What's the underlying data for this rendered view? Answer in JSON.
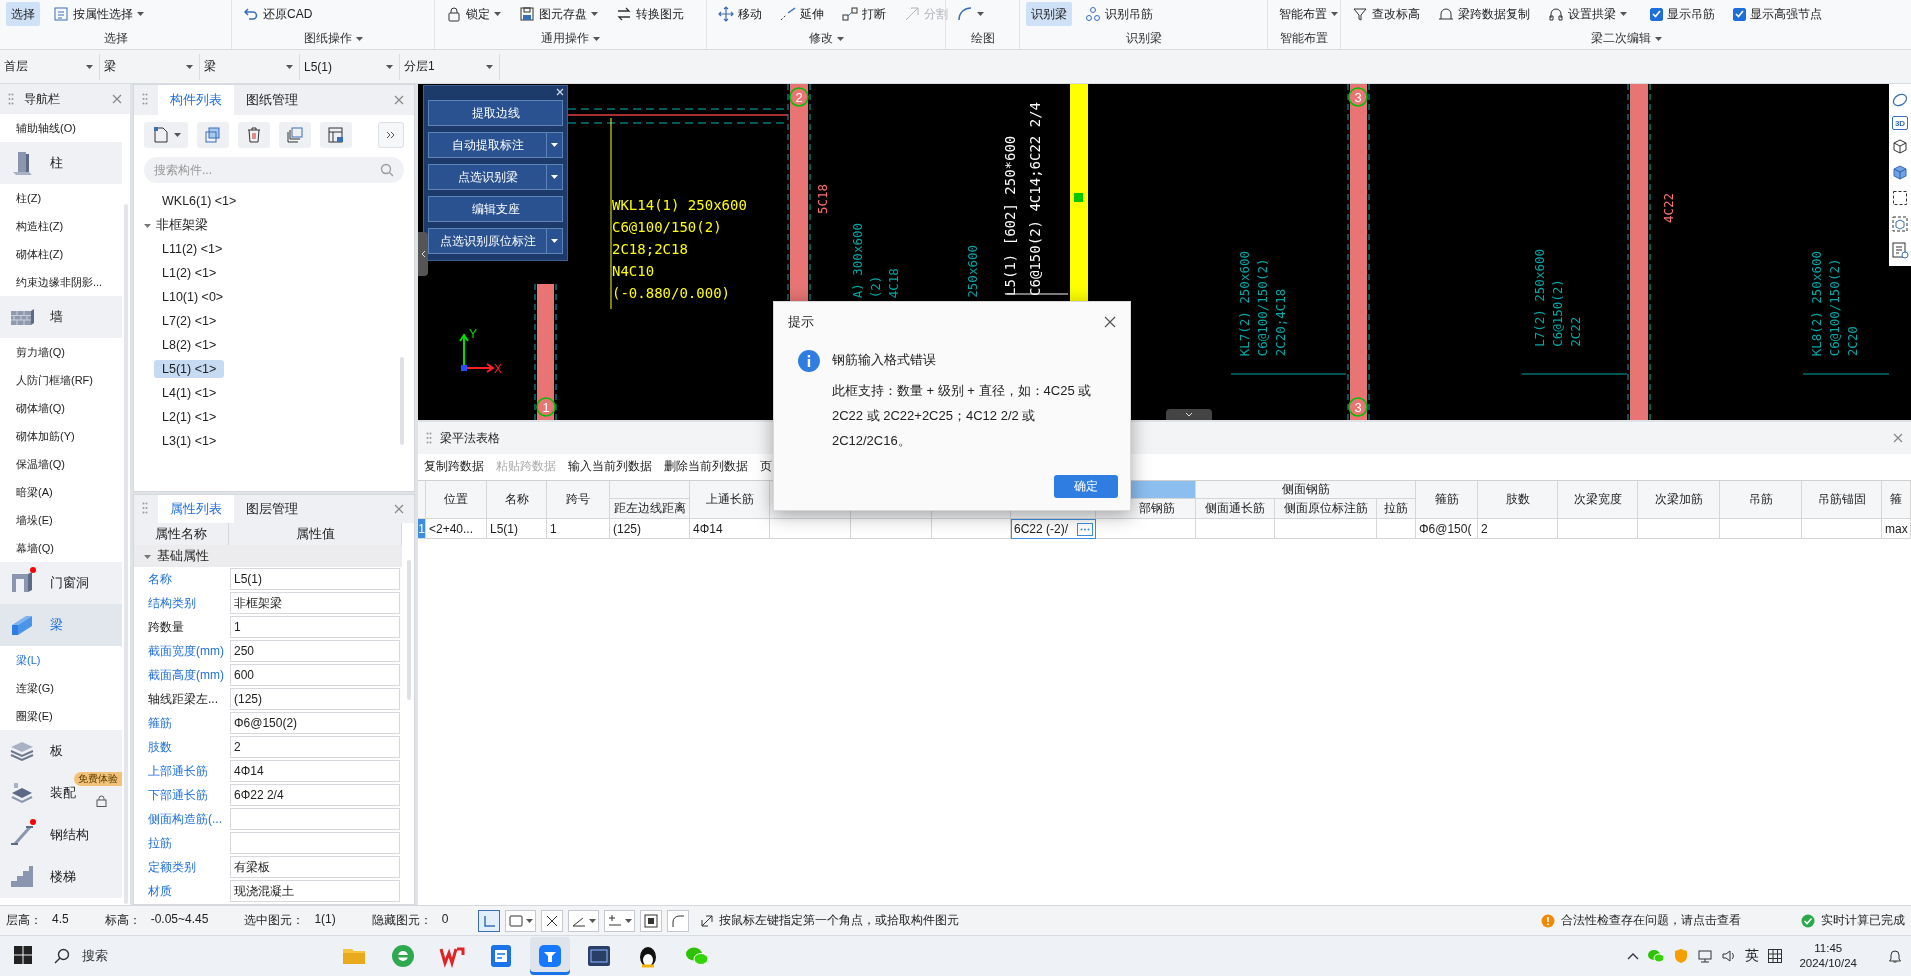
{
  "ribbon": {
    "groups": [
      {
        "label": "选择",
        "caret": false,
        "tools": [
          {
            "kind": "button",
            "label": "选择",
            "selected": true,
            "disabled": false,
            "caret": false
          },
          {
            "kind": "button",
            "label": "按属性选择",
            "selected": false,
            "disabled": false,
            "caret": true
          }
        ]
      },
      {
        "label": "图纸操作",
        "caret": true,
        "tools": [
          {
            "kind": "button",
            "label": "还原CAD",
            "selected": false,
            "disabled": false,
            "caret": false
          }
        ]
      },
      {
        "label": "通用操作",
        "caret": true,
        "tools": [
          {
            "kind": "button",
            "label": "锁定",
            "selected": false,
            "disabled": false,
            "caret": true
          },
          {
            "kind": "button",
            "label": "图元存盘",
            "selected": false,
            "disabled": false,
            "caret": true
          },
          {
            "kind": "button",
            "label": "转换图元",
            "selected": false,
            "disabled": false,
            "caret": false
          }
        ]
      },
      {
        "label": "修改",
        "caret": true,
        "tools": [
          {
            "kind": "button",
            "label": "移动",
            "selected": false,
            "disabled": false,
            "caret": false
          },
          {
            "kind": "button",
            "label": "延伸",
            "selected": false,
            "disabled": false,
            "caret": false
          },
          {
            "kind": "button",
            "label": "打断",
            "selected": false,
            "disabled": false,
            "caret": false
          },
          {
            "kind": "button",
            "label": "分割",
            "selected": false,
            "disabled": true,
            "caret": false
          }
        ]
      },
      {
        "label": "绘图",
        "caret": false,
        "tools": [
          {
            "kind": "button",
            "selected": false,
            "disabled": false,
            "caret": true
          }
        ]
      },
      {
        "label": "识别梁",
        "caret": false,
        "tools": [
          {
            "kind": "button",
            "label": "识别梁",
            "selected": true,
            "disabled": false,
            "caret": false
          },
          {
            "kind": "button",
            "label": "识别吊筋",
            "selected": false,
            "disabled": false,
            "caret": false
          }
        ]
      },
      {
        "label": "智能布置",
        "caret": false,
        "tools": [
          {
            "kind": "button",
            "label": "智能布置",
            "selected": false,
            "disabled": false,
            "caret": true
          }
        ]
      },
      {
        "label": "梁二次编辑",
        "caret": true,
        "tools": [
          {
            "kind": "button",
            "label": "查改标高",
            "selected": false,
            "disabled": false,
            "caret": false
          },
          {
            "kind": "button",
            "label": "梁跨数据复制",
            "selected": false,
            "disabled": false,
            "caret": false
          },
          {
            "kind": "button",
            "label": "设置拱梁",
            "selected": false,
            "disabled": false,
            "caret": true
          },
          {
            "kind": "checkbox",
            "label": "显示吊筋",
            "checked": true
          },
          {
            "kind": "checkbox",
            "label": "显示高强节点",
            "checked": true
          }
        ]
      }
    ]
  },
  "selectors": [
    {
      "value": "首层"
    },
    {
      "value": "梁"
    },
    {
      "value": "梁"
    },
    {
      "value": "L5(1)"
    },
    {
      "value": "分层1"
    }
  ],
  "navigator": {
    "title": "导航栏",
    "entries": [
      {
        "kind": "item",
        "label": "辅助轴线(O)",
        "selected": false
      },
      {
        "kind": "category",
        "label": "柱",
        "selected": false,
        "notified": false
      },
      {
        "kind": "item",
        "label": "柱(Z)",
        "selected": false
      },
      {
        "kind": "item",
        "label": "构造柱(Z)",
        "selected": false
      },
      {
        "kind": "item",
        "label": "砌体柱(Z)",
        "selected": false
      },
      {
        "kind": "item",
        "label": "约束边缘非阴影...",
        "selected": false
      },
      {
        "kind": "category",
        "label": "墙",
        "selected": false,
        "notified": false
      },
      {
        "kind": "item",
        "label": "剪力墙(Q)",
        "selected": false
      },
      {
        "kind": "item",
        "label": "人防门框墙(RF)",
        "selected": false
      },
      {
        "kind": "item",
        "label": "砌体墙(Q)",
        "selected": false
      },
      {
        "kind": "item",
        "label": "砌体加筋(Y)",
        "selected": false
      },
      {
        "kind": "item",
        "label": "保温墙(Q)",
        "selected": false
      },
      {
        "kind": "item",
        "label": "暗梁(A)",
        "selected": false
      },
      {
        "kind": "item",
        "label": "墙垛(E)",
        "selected": false
      },
      {
        "kind": "item",
        "label": "幕墙(Q)",
        "selected": false
      },
      {
        "kind": "category",
        "label": "门窗洞",
        "selected": false,
        "notified": true
      },
      {
        "kind": "category",
        "label": "梁",
        "selected": true,
        "notified": false
      },
      {
        "kind": "item",
        "label": "梁(L)",
        "selected": true
      },
      {
        "kind": "item",
        "label": "连梁(G)",
        "selected": false
      },
      {
        "kind": "item",
        "label": "圈梁(E)",
        "selected": false
      },
      {
        "kind": "category",
        "label": "板",
        "selected": false,
        "notified": false
      },
      {
        "kind": "category",
        "label": "装配",
        "selected": false,
        "notified": false,
        "badge": "免费体验"
      },
      {
        "kind": "category",
        "label": "钢结构",
        "selected": false,
        "notified": true
      },
      {
        "kind": "category",
        "label": "楼梯",
        "selected": false,
        "notified": false
      }
    ]
  },
  "parts_panel": {
    "tabs": [
      {
        "label": "构件列表",
        "selected": true
      },
      {
        "label": "图纸管理",
        "selected": false
      }
    ],
    "search": {
      "placeholder": "搜索构件..."
    },
    "tree": [
      {
        "label": "WKL6(1) <1>",
        "selected": false
      },
      {
        "label": "非框架梁",
        "selected": false,
        "expanded": true,
        "children": [
          {
            "label": "L11(2) <1>",
            "selected": false
          },
          {
            "label": "L1(2) <1>",
            "selected": false
          },
          {
            "label": "L10(1) <0>",
            "selected": false
          },
          {
            "label": "L7(2) <1>",
            "selected": false
          },
          {
            "label": "L8(2) <1>",
            "selected": false
          },
          {
            "label": "L5(1) <1>",
            "selected": true
          },
          {
            "label": "L4(1) <1>",
            "selected": false
          },
          {
            "label": "L2(1) <1>",
            "selected": false
          },
          {
            "label": "L3(1) <1>",
            "selected": false
          }
        ]
      }
    ]
  },
  "properties_panel": {
    "tabs": [
      {
        "label": "属性列表",
        "selected": true
      },
      {
        "label": "图层管理",
        "selected": false
      }
    ],
    "columns": [
      "属性名称",
      "属性值"
    ],
    "groups": [
      {
        "label": "基础属性",
        "expanded": true,
        "rows": [
          {
            "name": "名称",
            "value": "L5(1)",
            "public": true
          },
          {
            "name": "结构类别",
            "value": "非框架梁",
            "public": true
          },
          {
            "name": "跨数量",
            "value": "1",
            "public": false
          },
          {
            "name": "截面宽度(mm)",
            "value": "250",
            "public": true
          },
          {
            "name": "截面高度(mm)",
            "value": "600",
            "public": true
          },
          {
            "name": "轴线距梁左...",
            "value": "(125)",
            "public": false
          },
          {
            "name": "箍筋",
            "value": "Φ6@150(2)",
            "public": true
          },
          {
            "name": "肢数",
            "value": "2",
            "public": true
          },
          {
            "name": "上部通长筋",
            "value": "4Φ14",
            "public": true
          },
          {
            "name": "下部通长筋",
            "value": "6Φ22 2/4",
            "public": true
          },
          {
            "name": "侧面构造筋(...",
            "public": true
          },
          {
            "name": "拉筋",
            "public": true
          },
          {
            "name": "定额类别",
            "value": "有梁板",
            "public": true
          },
          {
            "name": "材质",
            "value": "现浇混凝土",
            "public": true
          }
        ]
      }
    ]
  },
  "cad_view": {
    "tool_panel": {
      "buttons": [
        {
          "label": "提取边线",
          "dropdown": false
        },
        {
          "label": "自动提取标注",
          "dropdown": true
        },
        {
          "label": "点选识别梁",
          "dropdown": true
        },
        {
          "label": "编辑支座",
          "dropdown": false
        },
        {
          "label": "点选识别原位标注",
          "dropdown": true
        }
      ]
    },
    "axis_bubbles": [
      {
        "label": "2"
      },
      {
        "label": "3"
      },
      {
        "label": "1"
      },
      {
        "label": "3"
      }
    ],
    "annotations": [
      {
        "kind": "horizontal",
        "color": "#ffff00",
        "lines": [
          "WKL14(1) 250x600",
          "C6@100/150(2)",
          "2C18;2C18",
          "N4C10",
          "(-0.880/0.000)"
        ]
      },
      {
        "kind": "vertical",
        "color": "#ff7070",
        "lines": [
          "5C18"
        ]
      },
      {
        "kind": "vertical",
        "color": "#00a8a8",
        "lines": [
          "A) 300x600",
          "(2)",
          "4C18"
        ]
      },
      {
        "kind": "vertical",
        "color": "#00a8a8",
        "lines": [
          "250x600"
        ]
      },
      {
        "kind": "vertical",
        "color": "#ffffff",
        "lines": [
          "L5(1) [602] 250*600",
          "C6@150(2) 4C14;6C22 2/4"
        ]
      },
      {
        "kind": "vertical",
        "color": "#00a8a8",
        "lines": [
          "KL7(2) 250x600",
          "C6@100/150(2)",
          "2C20;4C18"
        ]
      },
      {
        "kind": "vertical",
        "color": "#00a8a8",
        "lines": [
          "L7(2) 250x600",
          "C6@150(2)",
          "2C22"
        ]
      },
      {
        "kind": "vertical",
        "color": "#00a8a8",
        "lines": [
          "KL8(2) 250x600",
          "C6@100/150(2)",
          "2C20"
        ]
      },
      {
        "kind": "vertical",
        "color": "#ff7070",
        "lines": [
          "4C22"
        ]
      }
    ],
    "axis_gizmo": {
      "x_label": "X",
      "y_label": "Y"
    },
    "view_toolbar": [
      {
        "kind": "orbit"
      },
      {
        "kind": "text",
        "label": "3D"
      },
      {
        "kind": "cube"
      },
      {
        "kind": "solid-cube"
      },
      {
        "kind": "marquee"
      },
      {
        "kind": "box"
      },
      {
        "kind": "list"
      }
    ]
  },
  "table_panel": {
    "title": "梁平法表格",
    "toolbar": [
      {
        "label": "复制跨数据",
        "disabled": false
      },
      {
        "label": "粘贴跨数据",
        "disabled": true
      },
      {
        "label": "输入当前列数据",
        "disabled": false
      },
      {
        "label": "删除当前列数据",
        "disabled": false
      },
      {
        "label": "页",
        "disabled": false
      }
    ],
    "columns": [
      {
        "kind": "header",
        "label": "位置",
        "grouped": false
      },
      {
        "kind": "header",
        "label": "名称",
        "grouped": false
      },
      {
        "kind": "header",
        "label": "跨号",
        "grouped": false
      },
      {
        "kind": "header",
        "label": "距左边线距离",
        "group": {
          "selected": false
        }
      },
      {
        "kind": "header",
        "label": "上通长筋",
        "grouped": false
      },
      {
        "kind": "blank",
        "grouped": false
      },
      {
        "kind": "blank",
        "grouped": false
      },
      {
        "kind": "blank",
        "grouped": false
      },
      {
        "kind": "blank",
        "group": {
          "selected": true
        }
      },
      {
        "kind": "header",
        "label": "部钢筋",
        "grouped": true
      },
      {
        "kind": "header",
        "label": "侧面通长筋",
        "group": {
          "label": "侧面钢筋",
          "selected": false
        }
      },
      {
        "kind": "header",
        "label": "侧面原位标注筋",
        "grouped": true
      },
      {
        "kind": "header",
        "label": "拉筋",
        "grouped": true
      },
      {
        "kind": "header",
        "label": "箍筋",
        "grouped": false
      },
      {
        "kind": "header",
        "label": "肢数",
        "grouped": false
      },
      {
        "kind": "header",
        "label": "次梁宽度",
        "grouped": false
      },
      {
        "kind": "header",
        "label": "次梁加筋",
        "grouped": false
      },
      {
        "kind": "header",
        "label": "吊筋",
        "grouped": false
      },
      {
        "kind": "header",
        "label": "吊筋锚固",
        "grouped": false
      },
      {
        "kind": "header",
        "label": "箍",
        "grouped": false
      }
    ],
    "rows": [
      {
        "number": "1",
        "selected": true,
        "cells": [
          {
            "text": "<2+40...",
            "editing": false
          },
          {
            "text": "L5(1)",
            "editing": false
          },
          {
            "text": "1",
            "editing": false
          },
          {
            "text": "(125)",
            "editing": false
          },
          {
            "text": "4Φ14",
            "editing": false
          },
          {
            "editing": false
          },
          {
            "editing": false
          },
          {
            "editing": false
          },
          {
            "text": "6C22 (-2)/",
            "editing": true
          },
          {
            "editing": false
          },
          {
            "editing": false
          },
          {
            "editing": false
          },
          {
            "editing": false
          },
          {
            "text": "Φ6@150(",
            "editing": false
          },
          {
            "text": "2",
            "editing": false
          },
          {
            "editing": false
          },
          {
            "editing": false
          },
          {
            "editing": false
          },
          {
            "editing": false
          },
          {
            "text": "max",
            "editing": false
          }
        ]
      }
    ]
  },
  "status_bar": {
    "fields": [
      {
        "label": "层高：",
        "value": "4.5"
      },
      {
        "label": "标高：",
        "value": "-0.05~4.45"
      },
      {
        "label": "选中图元：",
        "value": "1(1)"
      },
      {
        "label": "隐藏图元：",
        "value": "0"
      }
    ],
    "tools": [
      {
        "selected": true,
        "caret": false
      },
      {
        "selected": false,
        "caret": true
      },
      {
        "selected": false,
        "caret": false
      },
      {
        "selected": false,
        "caret": true
      },
      {
        "selected": false,
        "caret": true
      },
      {
        "selected": false,
        "caret": false
      },
      {
        "selected": false,
        "caret": false
      }
    ],
    "hint": "按鼠标左键指定第一个角点，或拾取构件图元",
    "warning": "合法性检查存在问题，请点击查看",
    "progress": "实时计算已完成"
  },
  "taskbar": {
    "search": {
      "placeholder": "搜索"
    },
    "apps": [
      {
        "selected": false
      },
      {
        "selected": false
      },
      {
        "selected": false
      },
      {
        "selected": false
      },
      {
        "selected": true
      },
      {
        "selected": false
      },
      {
        "selected": false
      },
      {
        "selected": false
      }
    ],
    "tray": {
      "input_method": "英",
      "time": "11:45",
      "date": "2024/10/24"
    }
  },
  "dialog": {
    "title": "提示",
    "heading": "钢筋输入格式错误",
    "message": "此框支持：数量 + 级别 + 直径，如：4C25 或 2C22 或 2C22+2C25；4C12 2/2 或 2C12/2C16。",
    "buttons": [
      {
        "label": "确定",
        "primary": true
      }
    ]
  }
}
